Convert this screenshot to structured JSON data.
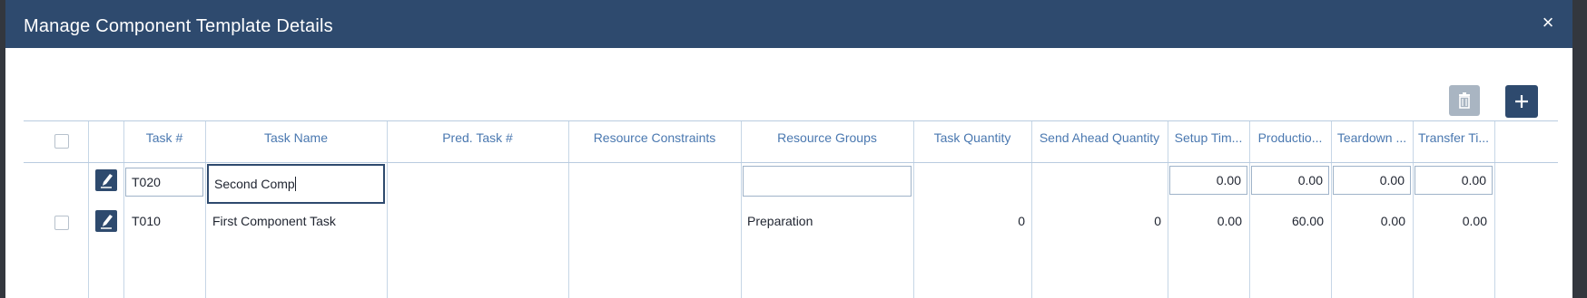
{
  "dialog": {
    "title": "Manage Component Template Details",
    "close_glyph": "×"
  },
  "toolbar": {
    "delete_icon": "trash-icon",
    "add_glyph": "+"
  },
  "table": {
    "columns": [
      "Task #",
      "Task Name",
      "Pred. Task #",
      "Resource Constraints",
      "Resource Groups",
      "Task Quantity",
      "Send Ahead Quantity",
      "Setup Tim...",
      "Productio...",
      "Teardown ...",
      "Transfer Ti..."
    ],
    "edit_row": {
      "task_num": "T020",
      "task_name": "Second Comp",
      "resource_groups": "",
      "setup": "0.00",
      "production": "0.00",
      "teardown": "0.00",
      "transfer": "0.00"
    },
    "rows": [
      {
        "task_num": "T010",
        "task_name": "First Component Task",
        "pred": "",
        "constraints": "",
        "resource_groups": "Preparation",
        "task_qty": "0",
        "send_ahead": "0",
        "setup": "0.00",
        "production": "60.00",
        "teardown": "0.00",
        "transfer": "0.00"
      }
    ]
  },
  "colors": {
    "header_bg": "#2e4a6e",
    "column_header_text": "#4a78b0",
    "disabled_button": "#a9b5c2"
  }
}
